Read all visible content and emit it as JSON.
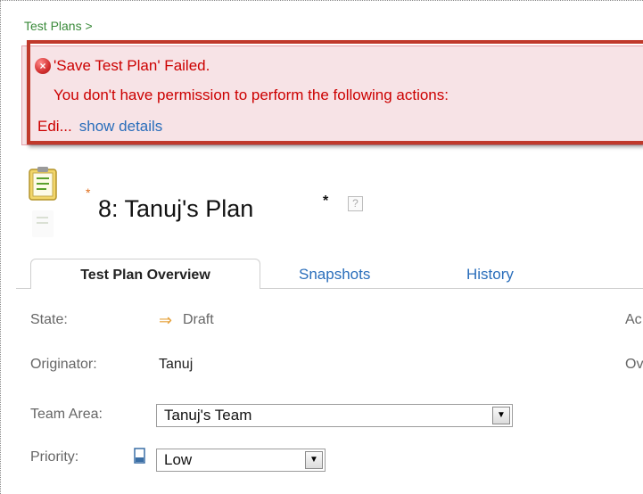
{
  "breadcrumb": "Test Plans >",
  "error": {
    "title": "'Save Test Plan' Failed.",
    "message": "You don't have permission to perform the following actions:",
    "truncated": "Edi...",
    "link": "show details"
  },
  "plan": {
    "title": "8: Tanuj's Plan",
    "required_star": "*",
    "dirty_star": "*",
    "help": "?"
  },
  "tabs": [
    {
      "label": "Test Plan Overview",
      "active": true
    },
    {
      "label": "Snapshots",
      "active": false
    },
    {
      "label": "History",
      "active": false
    }
  ],
  "fields": {
    "state_label": "State:",
    "state_value": "Draft",
    "originator_label": "Originator:",
    "originator_value": "Tanuj",
    "team_area_label": "Team Area:",
    "team_area_value": "Tanuj's Team",
    "priority_label": "Priority:",
    "priority_value": "Low",
    "right_col_1": "Ac",
    "right_col_2": "Ov"
  },
  "colors": {
    "error_text": "#cc0000",
    "link": "#2a6ebb",
    "breadcrumb": "#3a8a3a",
    "highlight_border": "#c0392b"
  },
  "icons": {
    "error": "error-circle-icon",
    "plan": "test-plan-icon",
    "help": "help-icon",
    "state": "arrow-right-icon",
    "priority": "priority-low-icon"
  }
}
